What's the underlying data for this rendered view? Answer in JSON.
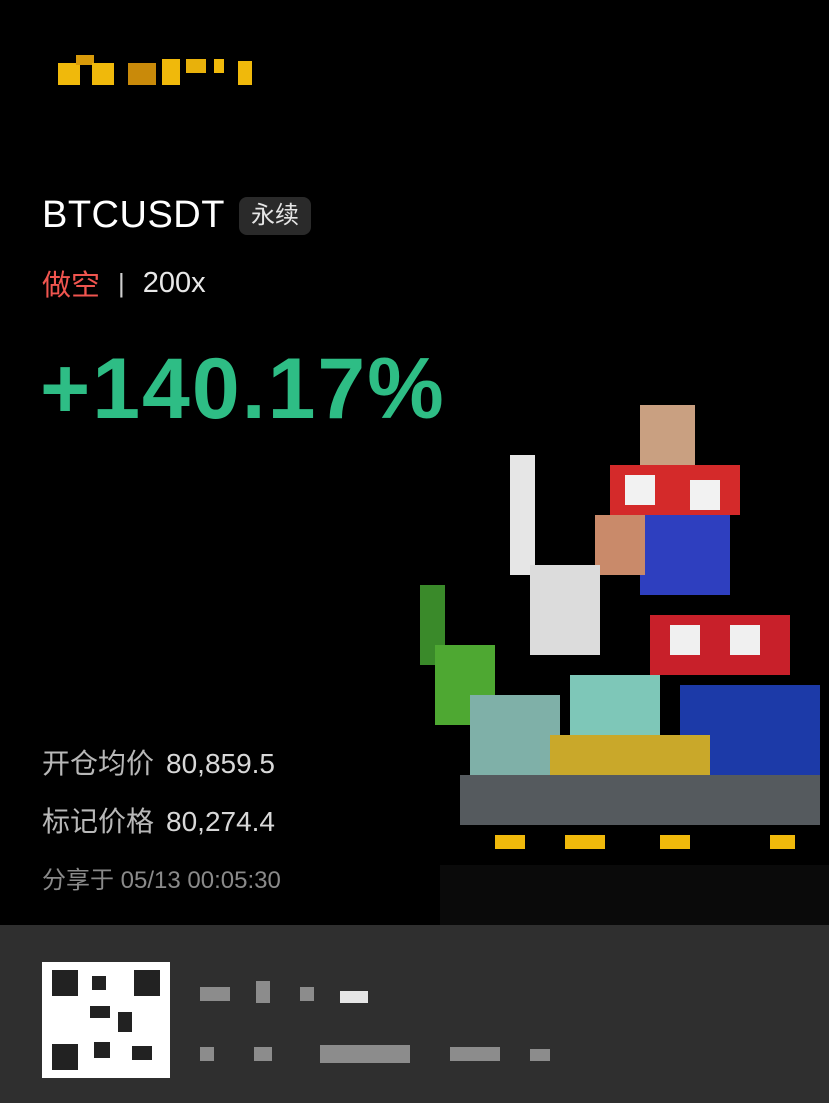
{
  "header": {
    "logo_icon": "pixelated-brand-logo",
    "logo_color": "#f0b90b"
  },
  "position": {
    "symbol": "BTCUSDT",
    "contract_tag": "永续",
    "side": "做空",
    "separator": "|",
    "leverage": "200x",
    "pnl_percent": "+140.17%",
    "entry_label": "开仓均价",
    "entry_value": "80,859.5",
    "mark_label": "标记价格",
    "mark_value": "80,274.4",
    "share_label": "分享于",
    "share_time": "05/13 00:05:30"
  },
  "colors": {
    "short": "#f0554f",
    "profit": "#2ebd85",
    "background": "#000000"
  },
  "artwork": {
    "icon": "pixelated-celebration-image"
  },
  "footer": {
    "qr_icon": "pixelated-qr-code-icon"
  }
}
